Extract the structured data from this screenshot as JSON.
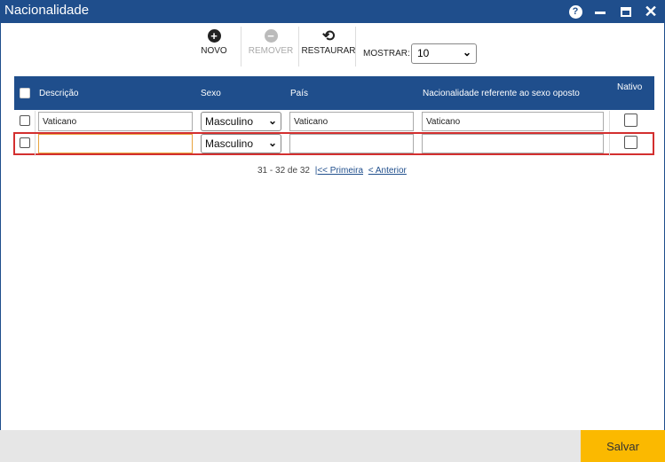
{
  "window": {
    "title": "Nacionalidade",
    "help_label": "?",
    "close_label": "✕"
  },
  "toolbar": {
    "novo": "NOVO",
    "remover": "REMOVER",
    "restaurar": "RESTAURAR",
    "mostrar_label": "MOSTRAR:",
    "mostrar_value": "10"
  },
  "grid": {
    "columns": {
      "descricao": "Descrição",
      "sexo": "Sexo",
      "pais": "País",
      "oposto": "Nacionalidade referente ao sexo oposto",
      "nativo": "Nativo"
    },
    "rows": [
      {
        "descricao": "Vaticano",
        "sexo": "Masculino",
        "pais": "Vaticano",
        "oposto": "Vaticano"
      },
      {
        "descricao": "",
        "sexo": "Masculino",
        "pais": "",
        "oposto": ""
      }
    ]
  },
  "pager": {
    "range": "31 - 32 de 32",
    "first": "|<< Primeira",
    "prev": "< Anterior"
  },
  "footer": {
    "save": "Salvar"
  },
  "colors": {
    "header": "#1f4e8c",
    "save": "#fbb900",
    "highlight": "#d32f2f"
  }
}
